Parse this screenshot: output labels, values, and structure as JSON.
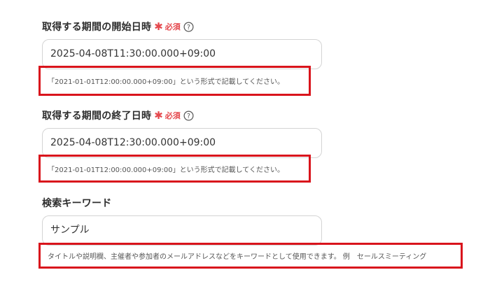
{
  "fields": [
    {
      "label": "取得する期間の開始日時",
      "required_text": "必須",
      "value": "2025-04-08T11:30:00.000+09:00",
      "hint": "「2021-01-01T12:00:00.000+09:00」という形式で記載してください。"
    },
    {
      "label": "取得する期間の終了日時",
      "required_text": "必須",
      "value": "2025-04-08T12:30:00.000+09:00",
      "hint": "「2021-01-01T12:00:00.000+09:00」という形式で記載してください。"
    },
    {
      "label": "検索キーワード",
      "value": "サンプル",
      "hint": "タイトルや説明欄、主催者や参加者のメールアドレスなどをキーワードとして使用できます。 例　セールスミーティング"
    }
  ],
  "colors": {
    "required": "#e5484d",
    "highlight": "#d9141c",
    "input_border": "#d4d4d4"
  },
  "icons": {
    "help": "question-circle-icon",
    "required": "asterisk-icon"
  }
}
